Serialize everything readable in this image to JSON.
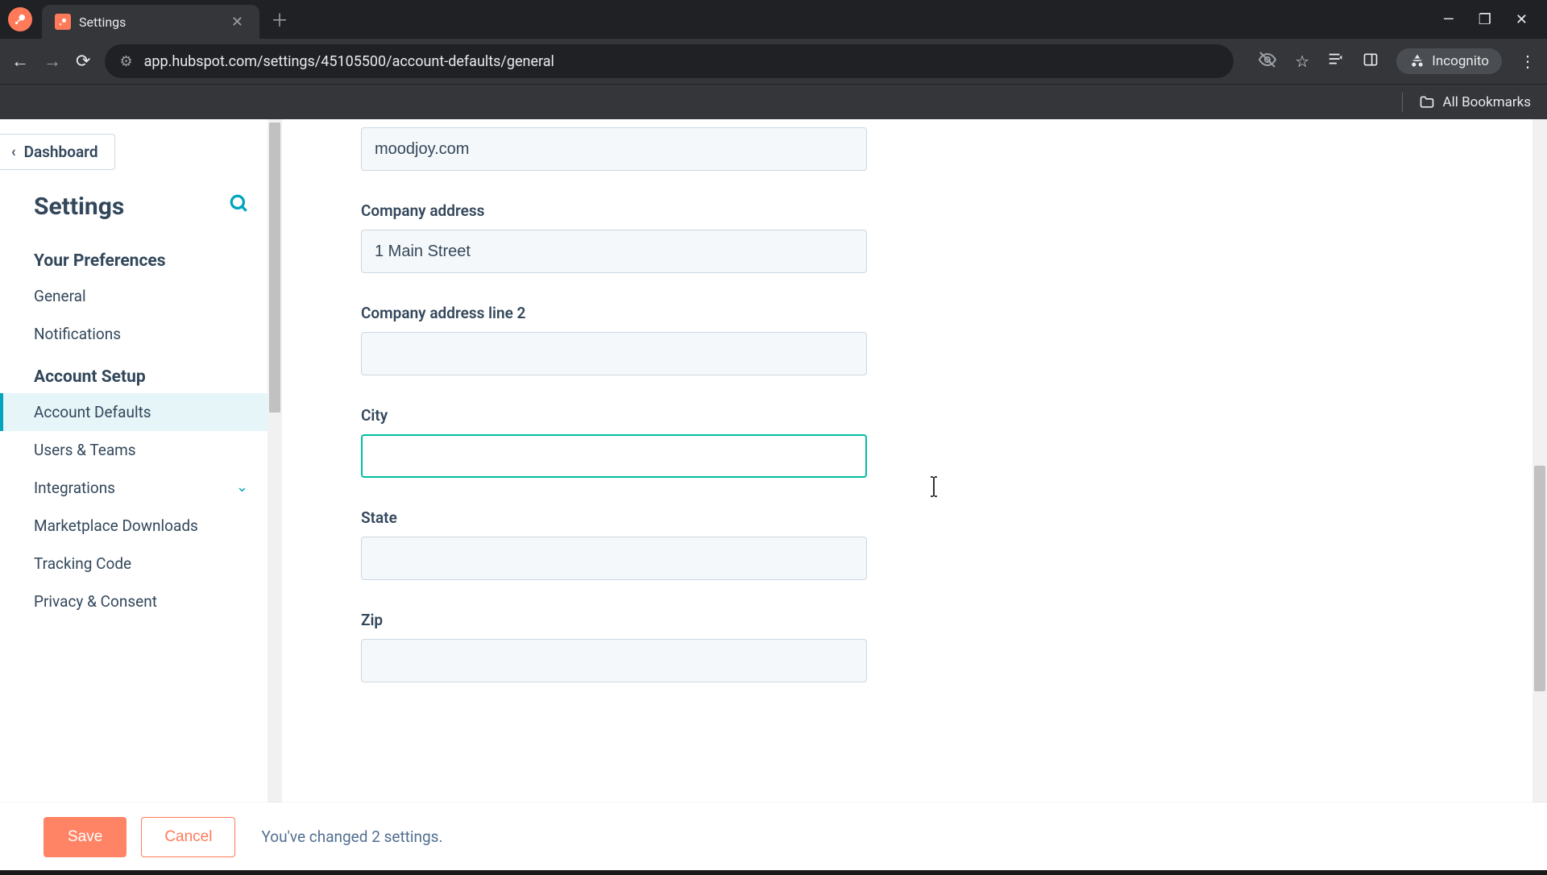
{
  "browser": {
    "tab_title": "Settings",
    "url": "app.hubspot.com/settings/45105500/account-defaults/general",
    "incognito_label": "Incognito",
    "all_bookmarks": "All Bookmarks"
  },
  "sidebar": {
    "back_label": "Dashboard",
    "title": "Settings",
    "sections": {
      "preferences": {
        "heading": "Your Preferences",
        "items": [
          "General",
          "Notifications"
        ]
      },
      "account_setup": {
        "heading": "Account Setup",
        "items": [
          "Account Defaults",
          "Users & Teams",
          "Integrations",
          "Marketplace Downloads",
          "Tracking Code",
          "Privacy & Consent"
        ]
      }
    }
  },
  "form": {
    "domain": {
      "value": "moodjoy.com"
    },
    "company_address": {
      "label": "Company address",
      "value": "1 Main Street"
    },
    "company_address2": {
      "label": "Company address line 2",
      "value": ""
    },
    "city": {
      "label": "City",
      "value": ""
    },
    "state": {
      "label": "State",
      "value": ""
    },
    "zip": {
      "label": "Zip",
      "value": ""
    }
  },
  "footer": {
    "save": "Save",
    "cancel": "Cancel",
    "message": "You've changed 2 settings."
  }
}
